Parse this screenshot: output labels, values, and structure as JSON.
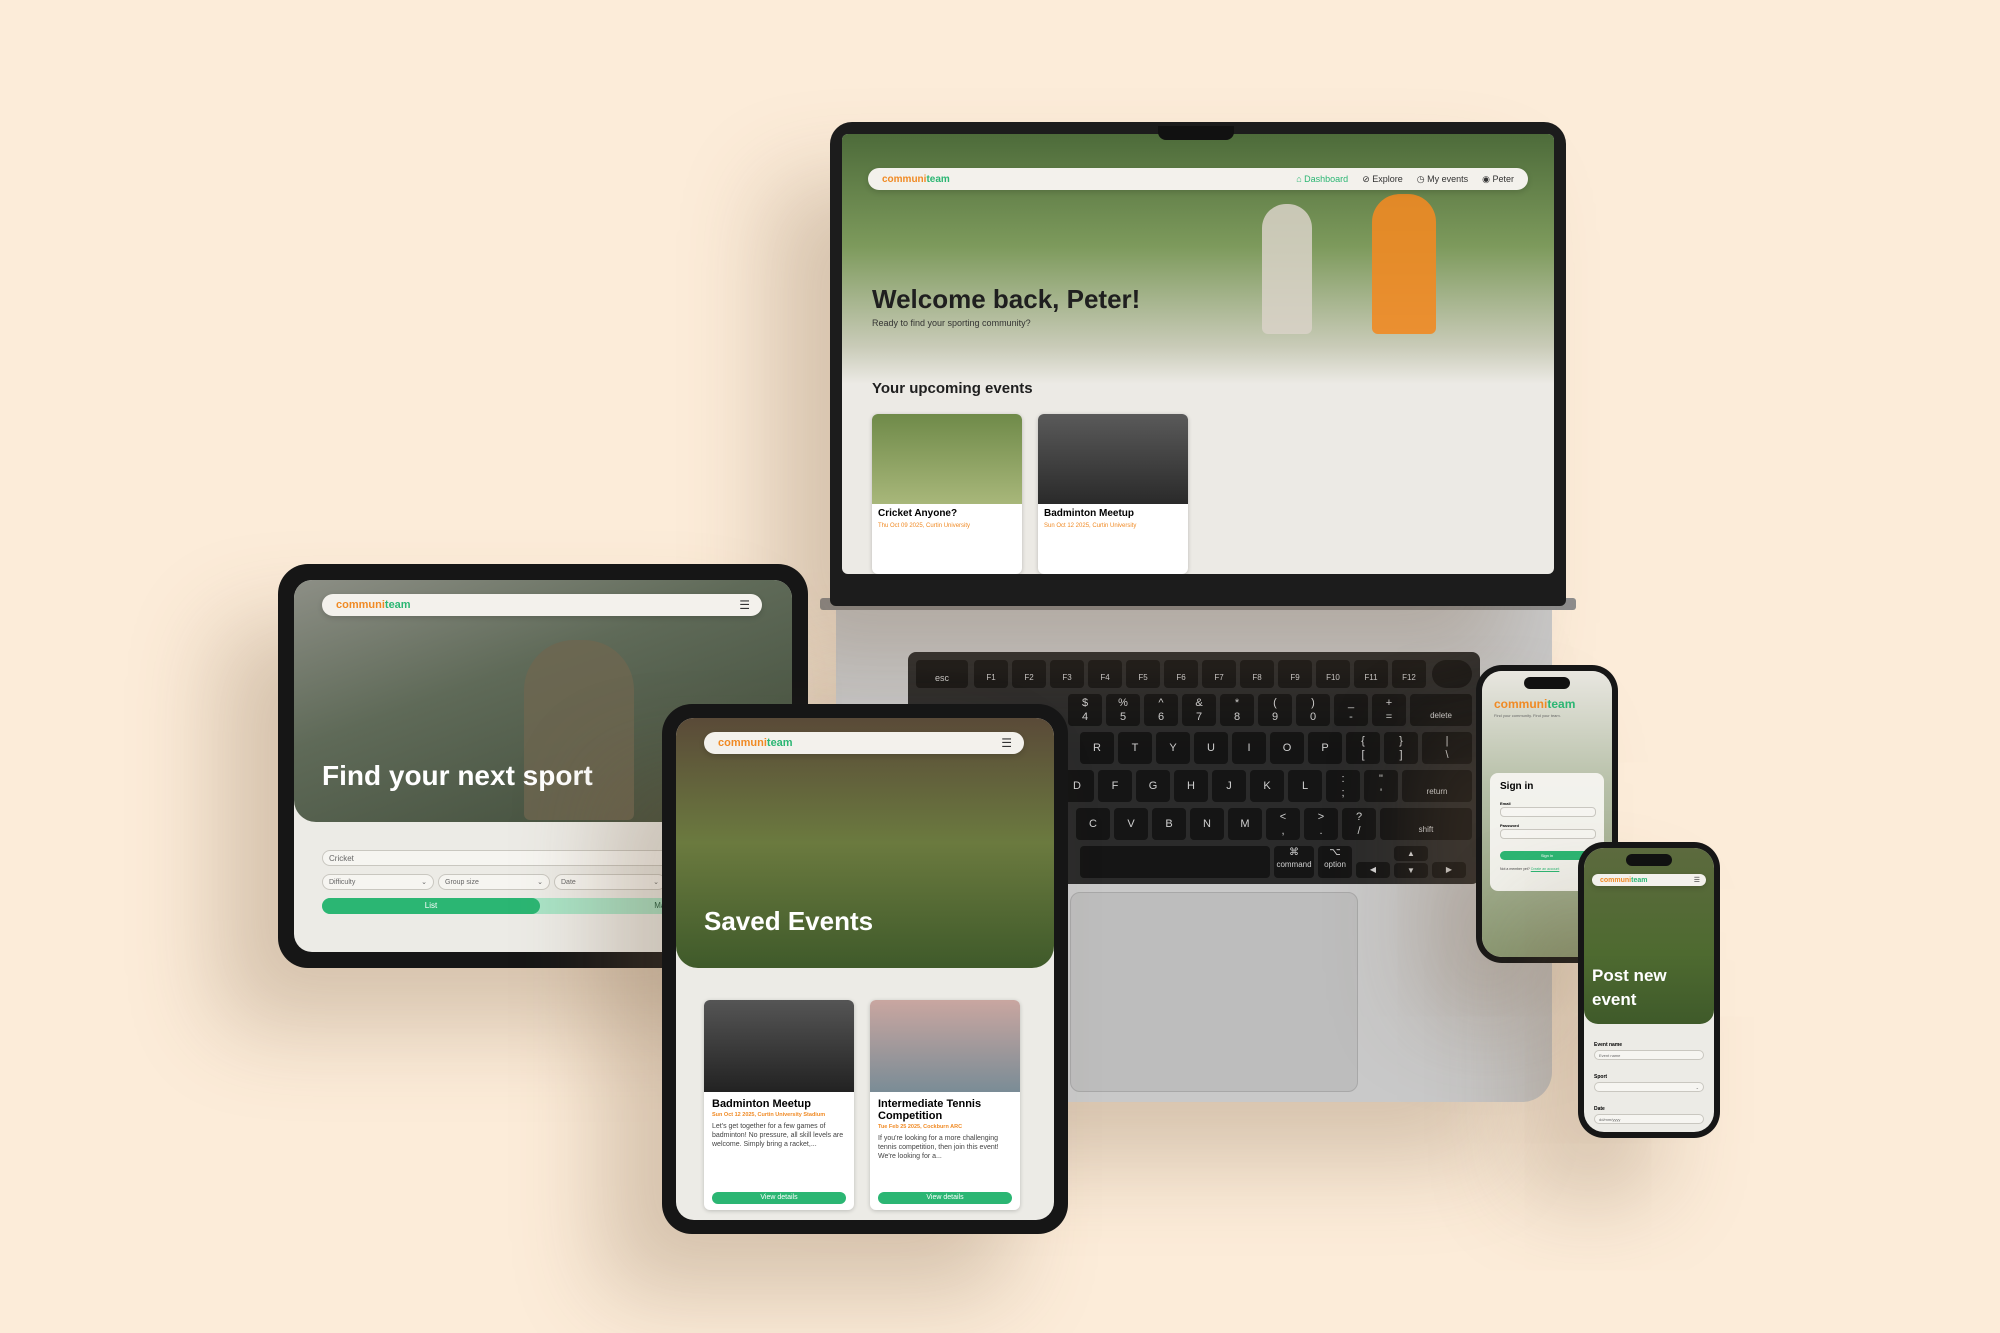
{
  "brand": {
    "part1": "communi",
    "part2": "team"
  },
  "colors": {
    "background": "#fcecd9",
    "accent_green": "#2bb673",
    "accent_orange": "#f08a24",
    "dark_green": "#3b5a2f"
  },
  "laptop": {
    "nav": [
      {
        "label": "Dashboard",
        "icon": "home-icon",
        "active": true
      },
      {
        "label": "Explore",
        "icon": "compass-icon"
      },
      {
        "label": "My events",
        "icon": "clock-icon"
      },
      {
        "label": "Peter",
        "icon": "user-icon"
      }
    ],
    "hero_title": "Welcome back, Peter!",
    "hero_subtitle": "Ready to find your sporting community?",
    "section_title": "Your upcoming events",
    "events": [
      {
        "title": "Cricket Anyone?",
        "meta": "Thu Oct 09 2025, Curtin University"
      },
      {
        "title": "Badminton Meetup",
        "meta": "Sun Oct 12 2025, Curtin University"
      }
    ]
  },
  "keyboard": {
    "fn_row": [
      "esc",
      "F1",
      "F2",
      "F3",
      "F4",
      "F5",
      "F6",
      "F7",
      "F8",
      "F9",
      "F10",
      "F11",
      "F12"
    ],
    "num_row": [
      "$\n4",
      "%\n5",
      "^\n6",
      "&\n7",
      "*\n8",
      "(\n9",
      ")\n0",
      "_\n-",
      "+\n="
    ],
    "row_q": [
      "R",
      "T",
      "Y",
      "U",
      "I",
      "O",
      "P",
      "{\n[",
      "}\n]",
      "|\n\\"
    ],
    "row_a": [
      "D",
      "F",
      "G",
      "H",
      "J",
      "K",
      "L",
      ":\n;",
      "\"\n'"
    ],
    "row_z": [
      "C",
      "V",
      "B",
      "N",
      "M",
      "<\n,",
      ">\n.",
      "?\n/"
    ],
    "delete": "delete",
    "return": "return",
    "shift": "shift",
    "command": "command",
    "option": "option",
    "command_sym": "⌘",
    "option_sym": "⌥"
  },
  "tablet_landscape": {
    "hero_title": "Find your next sport",
    "search_value": "Cricket",
    "filters": [
      "Difficulty",
      "Group size",
      "Date"
    ],
    "toggle": [
      "List",
      "Map"
    ]
  },
  "tablet_portrait": {
    "hero_title": "Saved Events",
    "cards": [
      {
        "title": "Badminton Meetup",
        "meta": "Sun Oct 12 2025, Curtin University Stadium",
        "desc": "Let's get together for a few games of badminton! No pressure, all skill levels are welcome. Simply bring a racket,...",
        "button": "View details"
      },
      {
        "title": "Intermediate Tennis Competition",
        "meta": "Tue Feb 25 2025, Cockburn ARC",
        "desc": "If you're looking for a more challenging tennis competition, then join this event! We're looking for a...",
        "button": "View details"
      }
    ]
  },
  "phone_signin": {
    "tagline": "Find your community. Find your team.",
    "title": "Sign in",
    "email_label": "Email",
    "password_label": "Password",
    "button": "Sign in",
    "footer": "Not a member yet?",
    "footer_link": "Create an account"
  },
  "phone_post": {
    "hero_title": "Post new event",
    "fields": [
      {
        "label": "Event name",
        "placeholder": "Event name"
      },
      {
        "label": "Sport",
        "placeholder": ""
      },
      {
        "label": "Date",
        "placeholder": "dd/mm/yyyy"
      }
    ]
  }
}
